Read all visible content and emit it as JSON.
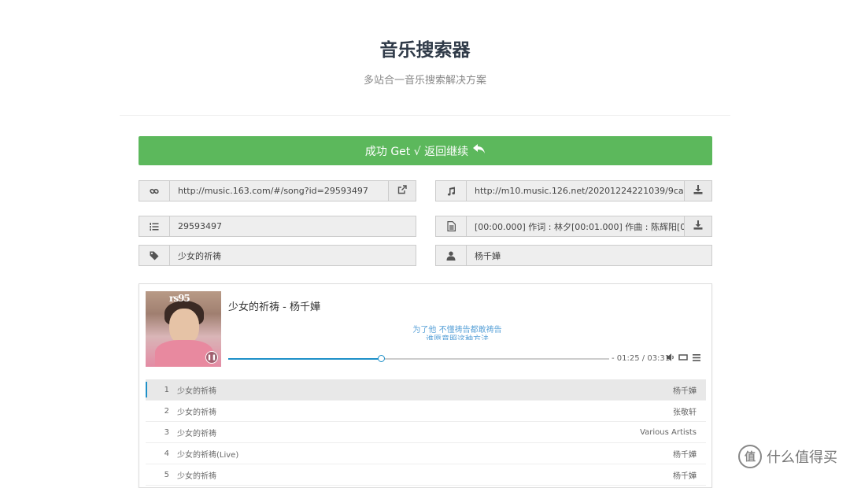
{
  "header": {
    "title": "音乐搜索器",
    "subtitle": "多站合一音乐搜索解决方案"
  },
  "result_button": {
    "label": "成功 Get √ 返回继续",
    "icon": "reply-icon"
  },
  "fields": {
    "link": {
      "icon": "link-icon",
      "value": "http://music.163.com/#/song?id=29593497",
      "action_icon": "external-link-icon"
    },
    "audio_url": {
      "icon": "music-icon",
      "value": "http://m10.music.126.net/20201224221039/9ca19...",
      "action_icon": "download-icon"
    },
    "song_id": {
      "icon": "list-ol-icon",
      "value": "29593497"
    },
    "lyrics": {
      "icon": "file-text-icon",
      "value": "[00:00.000] 作词 : 林夕[00:01.000] 作曲 : 陈辉阳[00...",
      "action_icon": "download-icon"
    },
    "song_name": {
      "icon": "tag-icon",
      "value": "少女的祈祷"
    },
    "artist": {
      "icon": "user-icon",
      "value": "杨千嬅"
    }
  },
  "player": {
    "now_playing": "少女的祈祷 - 杨千嬅",
    "lyric_line1": "为了他 不懂祷告都敢祷告",
    "lyric_line2": "谁愿意照这种方法",
    "time_display": "- 01:25 / 03:31",
    "progress": 0.4,
    "cover_logo_text": "rs95",
    "icons": [
      "pause-icon",
      "volume-icon",
      "loop-icon",
      "menu-icon"
    ],
    "playlist": [
      {
        "num": "1",
        "title": "少女的祈祷",
        "artist": "杨千嬅"
      },
      {
        "num": "2",
        "title": "少女的祈祷",
        "artist": "张敬轩"
      },
      {
        "num": "3",
        "title": "少女的祈祷",
        "artist": "Various Artists"
      },
      {
        "num": "4",
        "title": "少女的祈祷(Live)",
        "artist": "杨千嬅"
      },
      {
        "num": "5",
        "title": "少女的祈祷",
        "artist": "杨千嬅"
      }
    ]
  },
  "watermark": {
    "text": "什么值得买",
    "icon_glyph": "值"
  },
  "colors": {
    "success": "#5cb85c",
    "accent": "#1e90c8",
    "title": "#2f3a48"
  }
}
